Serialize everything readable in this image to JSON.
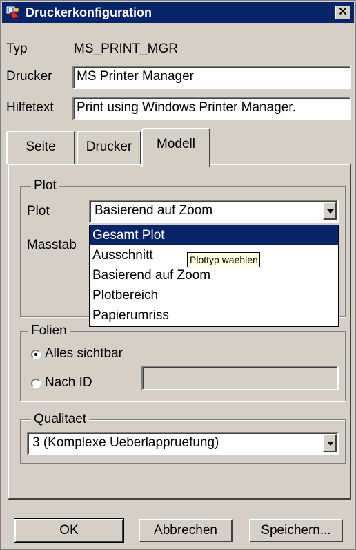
{
  "window": {
    "title": "Druckerkonfiguration",
    "close_glyph": "✕"
  },
  "fields": {
    "typ_label": "Typ",
    "typ_value": "MS_PRINT_MGR",
    "drucker_label": "Drucker",
    "drucker_value": "MS Printer Manager",
    "hilfetext_label": "Hilfetext",
    "hilfetext_value": "Print using Windows Printer Manager."
  },
  "tabs": [
    {
      "label": "Seite",
      "active": false
    },
    {
      "label": "Drucker",
      "active": false
    },
    {
      "label": "Modell",
      "active": true
    }
  ],
  "plot_group": {
    "legend": "Plot",
    "plot_label": "Plot",
    "plot_selected": "Basierend auf Zoom",
    "masstab_label": "Masstab",
    "options": [
      "Gesamt Plot",
      "Ausschnitt",
      "Basierend auf Zoom",
      "Plotbereich",
      "Papierumriss"
    ],
    "highlighted_option": "Gesamt Plot",
    "tooltip": "Plottyp waehlen."
  },
  "folien_group": {
    "legend": "Folien",
    "option_all": "Alles sichtbar",
    "option_id": "Nach ID",
    "selected": "Alles sichtbar",
    "id_value": ""
  },
  "qualitaet_group": {
    "legend": "Qualitaet",
    "selected": "3 (Komplexe Ueberlappruefung)"
  },
  "buttons": {
    "ok": "OK",
    "cancel": "Abbrechen",
    "save": "Speichern..."
  },
  "colors": {
    "title_bar": "#0a246a",
    "face": "#d4d0c8",
    "selection": "#0a246a",
    "tooltip_bg": "#ffffe1"
  },
  "icons": {
    "app": "printer-config-icon",
    "close": "close-icon",
    "dropdown": "chevron-down-icon"
  }
}
